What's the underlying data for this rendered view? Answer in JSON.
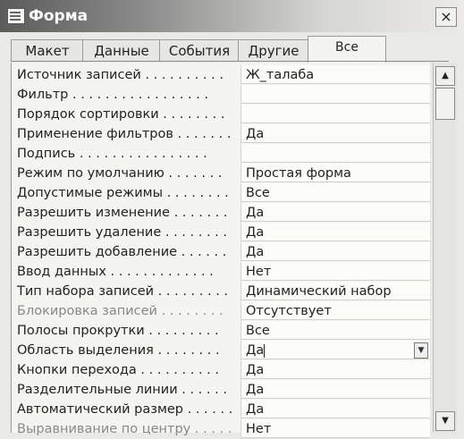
{
  "window": {
    "title": "Форма",
    "close_label": "×"
  },
  "tabs": [
    {
      "label": "Макет"
    },
    {
      "label": "Данные"
    },
    {
      "label": "События"
    },
    {
      "label": "Другие"
    },
    {
      "label": "Все",
      "active": true
    }
  ],
  "properties": [
    {
      "name": "Источник записей . . . . . . . . . .",
      "value": "Ж_талаба"
    },
    {
      "name": "Фильтр . . . . . . . . . . . . . . . . .",
      "value": ""
    },
    {
      "name": "Порядок сортировки . . . . . . . .",
      "value": ""
    },
    {
      "name": "Применение фильтров . . . . . . .",
      "value": "Да"
    },
    {
      "name": "Подпись . . . . . . . . . . . . . . . .",
      "value": ""
    },
    {
      "name": "Режим по умолчанию . . . . . . .",
      "value": "Простая форма"
    },
    {
      "name": "Допустимые режимы . . . . . . . .",
      "value": "Все"
    },
    {
      "name": "Разрешить изменение . . . . . . .",
      "value": "Да"
    },
    {
      "name": "Разрешить удаление . . . . . . . .",
      "value": "Да"
    },
    {
      "name": "Разрешить добавление . . . . . .",
      "value": "Да"
    },
    {
      "name": "Ввод данных . . . . . . . . . . . . .",
      "value": "Нет"
    },
    {
      "name": "Тип набора записей . . . . . . . . .",
      "value": "Динамический набор"
    },
    {
      "name": "Блокировка записей . . . . . . . .",
      "value": "Отсутствует"
    },
    {
      "name": "Полосы прокрутки . . . . . . . . .",
      "value": "Все"
    },
    {
      "name": "Область выделения . . . . . . . .",
      "value": "Да"
    },
    {
      "name": "Кнопки перехода . . . . . . . . . .",
      "value": "Да"
    },
    {
      "name": "Разделительные линии . . . . . .",
      "value": "Да"
    },
    {
      "name": "Автоматический размер . . . . . .",
      "value": "Да"
    },
    {
      "name": "Выравнивание по центру . . . . .",
      "value": "Нет"
    }
  ],
  "selected_property_index": 14,
  "icons": {
    "title": "form-icon",
    "dropdown": "dropdown-arrow-icon",
    "scroll_up": "scroll-up-arrow-icon",
    "scroll_down": "scroll-down-arrow-icon"
  }
}
